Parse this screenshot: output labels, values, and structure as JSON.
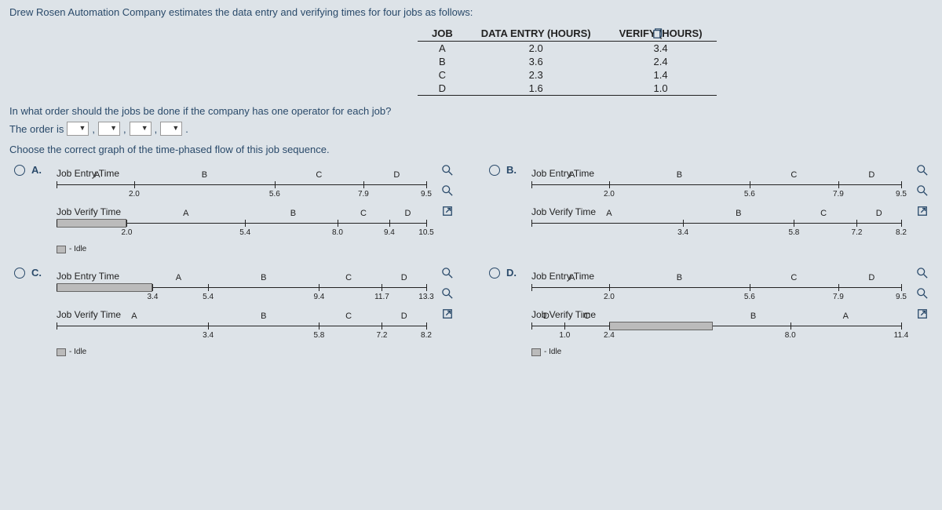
{
  "intro": "Drew Rosen Automation Company estimates the data entry and verifying times for four jobs as follows:",
  "table": {
    "headers": [
      "JOB",
      "DATA ENTRY (HOURS)",
      "VERIFY (HOURS)"
    ],
    "rows": [
      {
        "job": "A",
        "entry": "2.0",
        "verify": "3.4"
      },
      {
        "job": "B",
        "entry": "3.6",
        "verify": "2.4"
      },
      {
        "job": "C",
        "entry": "2.3",
        "verify": "1.4"
      },
      {
        "job": "D",
        "entry": "1.6",
        "verify": "1.0"
      }
    ]
  },
  "q1": "In what order should the jobs be done if the company has one operator for each job?",
  "order_prefix": "The order is",
  "choose": "Choose the correct graph of the time-phased flow of this job sequence.",
  "options": {
    "A": {
      "label": "A.",
      "entry_title": "Job Entry Time",
      "verify_title": "Job Verify Time",
      "entry_labels": [
        "A",
        "B",
        "C",
        "D"
      ],
      "entry_nums": [
        "2.0",
        "5.6",
        "7.9",
        "9.5"
      ],
      "verify_labels": [
        "A",
        "B",
        "C",
        "D"
      ],
      "verify_nums": [
        "2.0",
        "5.4",
        "8.0",
        "9.4",
        "10.5"
      ],
      "idle": "- Idle"
    },
    "B": {
      "label": "B.",
      "entry_title": "Job Entry Time",
      "verify_title": "Job Verify Time",
      "entry_labels": [
        "A",
        "B",
        "C",
        "D"
      ],
      "entry_nums": [
        "2.0",
        "5.6",
        "7.9",
        "9.5"
      ],
      "verify_labels": [
        "A",
        "B",
        "C",
        "D"
      ],
      "verify_nums": [
        "3.4",
        "5.8",
        "7.2",
        "8.2"
      ]
    },
    "C": {
      "label": "C.",
      "entry_title": "Job Entry Time",
      "verify_title": "Job Verify Time",
      "entry_labels": [
        "A",
        "B",
        "C",
        "D"
      ],
      "entry_nums": [
        "3.4",
        "5.4",
        "9.4",
        "11.7",
        "13.3"
      ],
      "verify_labels": [
        "A",
        "B",
        "C",
        "D"
      ],
      "verify_nums": [
        "3.4",
        "5.8",
        "7.2",
        "8.2"
      ],
      "idle": "- Idle"
    },
    "D": {
      "label": "D.",
      "entry_title": "Job Entry Time",
      "verify_title": "Job Verify Time",
      "entry_labels": [
        "A",
        "B",
        "C",
        "D"
      ],
      "entry_nums": [
        "2.0",
        "5.6",
        "7.9",
        "9.5"
      ],
      "verify_labels": [
        "D",
        "C",
        "B",
        "A"
      ],
      "verify_nums": [
        "1.0",
        "2.4",
        "8.0",
        "11.4"
      ],
      "idle": "- Idle"
    }
  },
  "chart_data": [
    {
      "type": "bar",
      "option": "A",
      "series": [
        {
          "name": "Job Entry Time",
          "segments": [
            {
              "job": "A",
              "start": 0.0,
              "end": 2.0
            },
            {
              "job": "B",
              "start": 2.0,
              "end": 5.6
            },
            {
              "job": "C",
              "start": 5.6,
              "end": 7.9
            },
            {
              "job": "D",
              "start": 7.9,
              "end": 9.5
            }
          ]
        },
        {
          "name": "Job Verify Time",
          "segments": [
            {
              "job": "Idle",
              "start": 0.0,
              "end": 2.0
            },
            {
              "job": "A",
              "start": 2.0,
              "end": 5.4
            },
            {
              "job": "B",
              "start": 5.4,
              "end": 8.0
            },
            {
              "job": "C",
              "start": 8.0,
              "end": 9.4
            },
            {
              "job": "D",
              "start": 9.4,
              "end": 10.5
            }
          ]
        }
      ]
    },
    {
      "type": "bar",
      "option": "B",
      "series": [
        {
          "name": "Job Entry Time",
          "segments": [
            {
              "job": "A",
              "start": 0.0,
              "end": 2.0
            },
            {
              "job": "B",
              "start": 2.0,
              "end": 5.6
            },
            {
              "job": "C",
              "start": 5.6,
              "end": 7.9
            },
            {
              "job": "D",
              "start": 7.9,
              "end": 9.5
            }
          ]
        },
        {
          "name": "Job Verify Time",
          "segments": [
            {
              "job": "A",
              "start": 0.0,
              "end": 3.4
            },
            {
              "job": "B",
              "start": 3.4,
              "end": 5.8
            },
            {
              "job": "C",
              "start": 5.8,
              "end": 7.2
            },
            {
              "job": "D",
              "start": 7.2,
              "end": 8.2
            }
          ]
        }
      ]
    },
    {
      "type": "bar",
      "option": "C",
      "series": [
        {
          "name": "Job Entry Time",
          "segments": [
            {
              "job": "Idle",
              "start": 0.0,
              "end": 3.4
            },
            {
              "job": "A",
              "start": 3.4,
              "end": 5.4
            },
            {
              "job": "B",
              "start": 5.4,
              "end": 9.4
            },
            {
              "job": "C",
              "start": 9.4,
              "end": 11.7
            },
            {
              "job": "D",
              "start": 11.7,
              "end": 13.3
            }
          ]
        },
        {
          "name": "Job Verify Time",
          "segments": [
            {
              "job": "A",
              "start": 0.0,
              "end": 3.4
            },
            {
              "job": "B",
              "start": 3.4,
              "end": 5.8
            },
            {
              "job": "C",
              "start": 5.8,
              "end": 7.2
            },
            {
              "job": "D",
              "start": 7.2,
              "end": 8.2
            }
          ]
        }
      ]
    },
    {
      "type": "bar",
      "option": "D",
      "series": [
        {
          "name": "Job Entry Time",
          "segments": [
            {
              "job": "A",
              "start": 0.0,
              "end": 2.0
            },
            {
              "job": "B",
              "start": 2.0,
              "end": 5.6
            },
            {
              "job": "C",
              "start": 5.6,
              "end": 7.9
            },
            {
              "job": "D",
              "start": 7.9,
              "end": 9.5
            }
          ]
        },
        {
          "name": "Job Verify Time",
          "segments": [
            {
              "job": "D",
              "start": 0.0,
              "end": 1.0
            },
            {
              "job": "C",
              "start": 1.0,
              "end": 2.4
            },
            {
              "job": "Idle",
              "start": 2.4,
              "end": 5.6
            },
            {
              "job": "B",
              "start": 5.6,
              "end": 8.0
            },
            {
              "job": "A",
              "start": 8.0,
              "end": 11.4
            }
          ]
        }
      ]
    }
  ]
}
